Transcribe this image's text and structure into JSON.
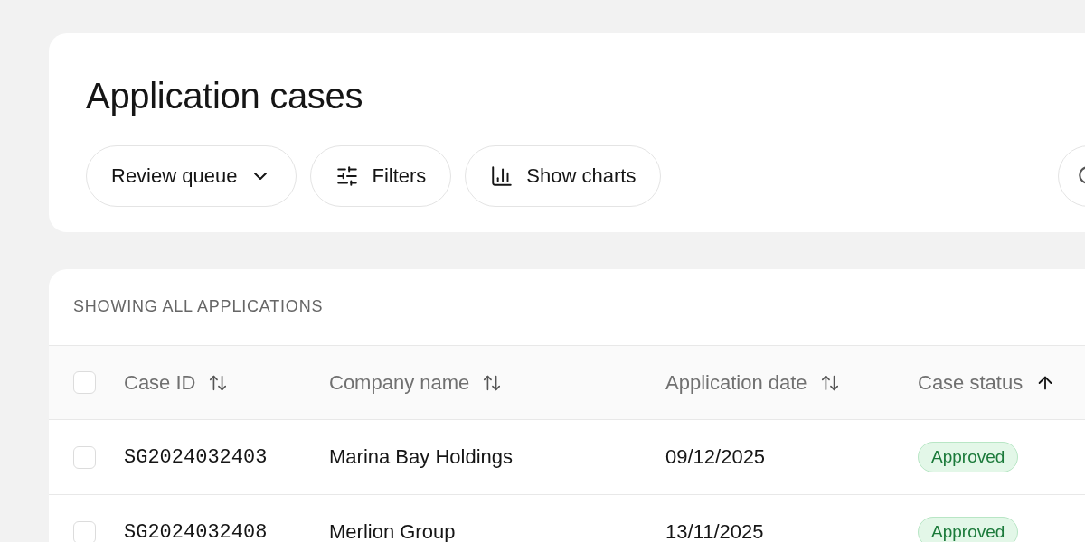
{
  "page": {
    "title": "Application cases"
  },
  "toolbar": {
    "buttons": [
      {
        "kind": "dropdown",
        "label": "Review queue"
      },
      {
        "kind": "filters",
        "label": "Filters"
      },
      {
        "kind": "charts",
        "label": "Show charts"
      }
    ],
    "search": {
      "kind": "search"
    }
  },
  "table": {
    "caption": "SHOWING ALL APPLICATIONS",
    "select_all": {
      "checked": false
    },
    "columns": [
      {
        "label": "Case ID",
        "sorted": false
      },
      {
        "label": "Company name",
        "sorted": false
      },
      {
        "label": "Application date",
        "sorted": false
      },
      {
        "label": "Case status",
        "sorted": true
      }
    ],
    "rows": [
      {
        "checked": false,
        "case_id": "SG2024032403",
        "company": "Marina Bay Holdings",
        "date": "09/12/2025",
        "status": "Approved"
      },
      {
        "checked": false,
        "case_id": "SG2024032408",
        "company": "Merlion Group",
        "date": "13/11/2025",
        "status": "Approved"
      }
    ]
  }
}
